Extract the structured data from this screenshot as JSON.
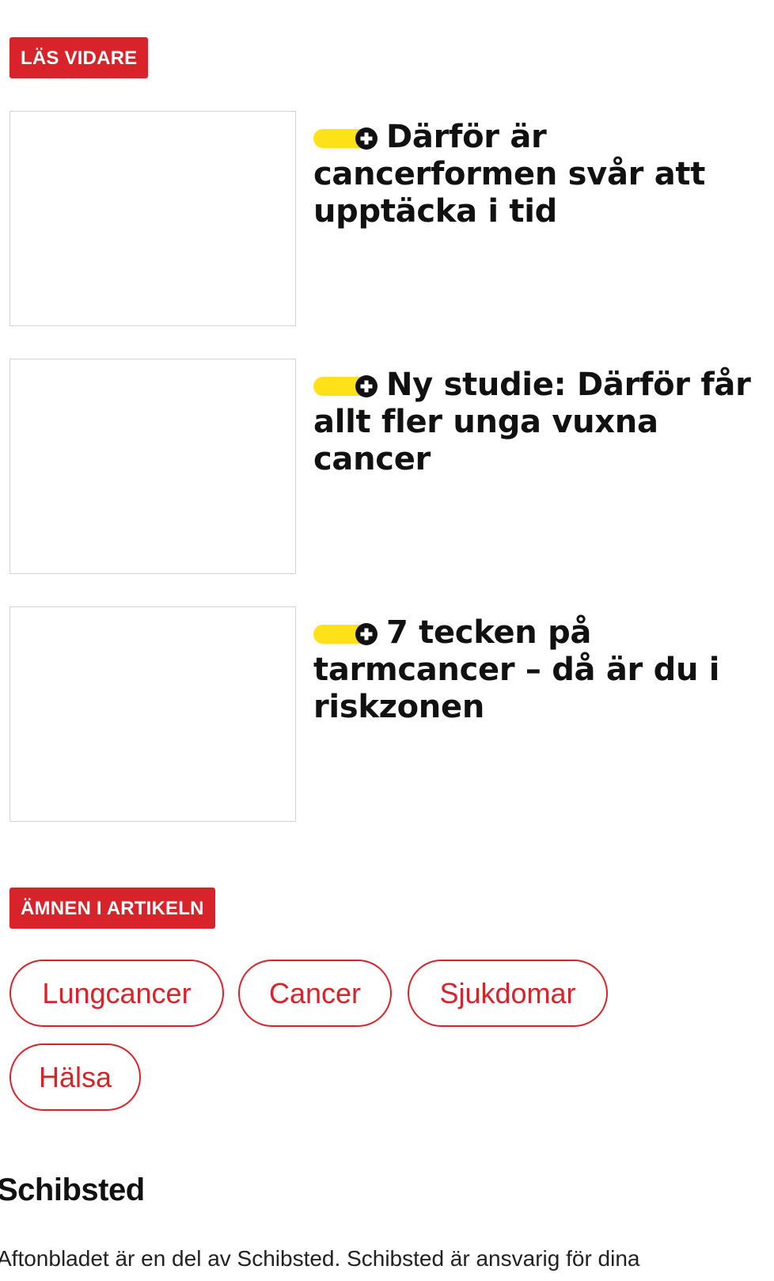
{
  "read_more": {
    "label": "LÄS VIDARE",
    "articles": [
      {
        "headline": "Därför är cancerformen svår att upptäcka i tid",
        "badge_icon": "plus-circle-icon"
      },
      {
        "headline": "Ny studie: Därför får allt fler unga vuxna cancer",
        "badge_icon": "plus-circle-icon"
      },
      {
        "headline": "7 tecken på tarmcancer – då är du i riskzonen",
        "badge_icon": "plus-circle-icon"
      }
    ]
  },
  "topics": {
    "label": "ÄMNEN I ARTIKELN",
    "tags": [
      "Lungcancer",
      "Cancer",
      "Sjukdomar",
      "Hälsa"
    ]
  },
  "footer": {
    "logo_text": "Schibsted",
    "text": "Aftonbladet är en del av Schibsted. Schibsted är ansvarig för dina"
  },
  "colors": {
    "accent_red": "#d8232a",
    "plus_yellow": "#ffe11a"
  }
}
